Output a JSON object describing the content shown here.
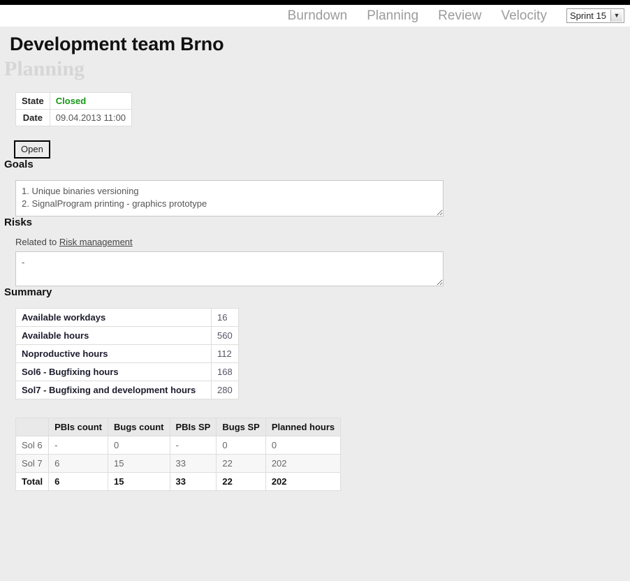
{
  "topbar": {
    "nav_items": [
      {
        "label": "Burndown"
      },
      {
        "label": "Planning"
      },
      {
        "label": "Review"
      },
      {
        "label": "Velocity"
      }
    ],
    "sprint_select": {
      "value": "Sprint 15",
      "arrow_icon": "chevron-down-icon"
    }
  },
  "page": {
    "title": "Development team Brno",
    "subtitle": "Planning"
  },
  "state_table": {
    "rows": [
      {
        "label": "State",
        "value": "Closed"
      },
      {
        "label": "Date",
        "value": "09.04.2013 11:00"
      }
    ]
  },
  "open_button": {
    "label": "Open"
  },
  "goals": {
    "heading": "Goals",
    "value": "1. Unique binaries versioning\n2. SignalProgram printing - graphics prototype",
    "placeholder": ""
  },
  "risks": {
    "heading": "Risks",
    "related_prefix": "Related to ",
    "related_link": "Risk management",
    "value": "-",
    "placeholder": ""
  },
  "summary": {
    "heading": "Summary",
    "rows": [
      {
        "label": "Available workdays",
        "value": "16"
      },
      {
        "label": "Available hours",
        "value": "560"
      },
      {
        "label": "Noproductive hours",
        "value": "112"
      },
      {
        "label": "Sol6 - Bugfixing hours",
        "value": "168"
      },
      {
        "label": "Sol7 - Bugfixing and development hours",
        "value": "280"
      }
    ]
  },
  "sol_table": {
    "headers": [
      "",
      "PBIs count",
      "Bugs count",
      "PBIs SP",
      "Bugs SP",
      "Planned hours"
    ],
    "rows": [
      {
        "label": "Sol 6",
        "cells": [
          "-",
          "0",
          "-",
          "0",
          "0"
        ]
      },
      {
        "label": "Sol 7",
        "cells": [
          "6",
          "15",
          "33",
          "22",
          "202"
        ]
      },
      {
        "label": "Total",
        "cells": [
          "6",
          "15",
          "33",
          "22",
          "202"
        ]
      }
    ]
  },
  "colors": {
    "state_ok": "#169616",
    "nav_link": "#9b9b9b",
    "subtitle": "#d6d6d6",
    "page_bg": "#ececec",
    "topstrip": "#000000"
  }
}
